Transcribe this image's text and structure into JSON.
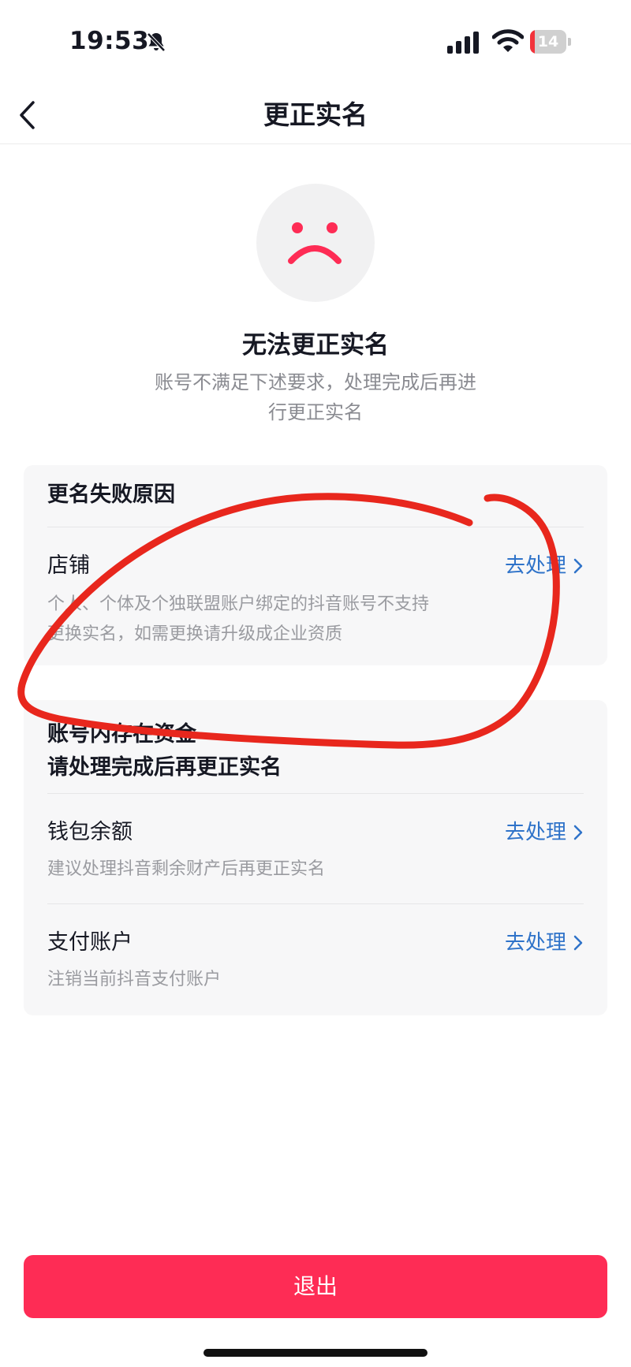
{
  "status_bar": {
    "time": "19:53",
    "battery_level": "14",
    "battery_fraction": 0.14
  },
  "nav": {
    "title": "更正实名"
  },
  "result": {
    "title": "无法更正实名",
    "desc_line1": "账号不满足下述要求，处理完成后再进",
    "desc_line2": "行更正实名"
  },
  "failure_card": {
    "header": "更名失败原因",
    "item": {
      "title": "店铺",
      "action": "去处理",
      "desc_line1": "个人、个体及个独联盟账户绑定的抖音账号不支持",
      "desc_line2": "更换实名，如需更换请升级成企业资质"
    }
  },
  "funds_card": {
    "header_line1": "账号内存在资金",
    "header_line2": "请处理完成后再更正实名",
    "items": [
      {
        "title": "钱包余额",
        "action": "去处理",
        "desc": "建议处理抖音剩余财产后再更正实名"
      },
      {
        "title": "支付账户",
        "action": "去处理",
        "desc": "注销当前抖音支付账户"
      }
    ]
  },
  "footer": {
    "exit_label": "退出"
  },
  "colors": {
    "accent_red": "#fe2c55",
    "link_blue": "#2f73c9",
    "annotation_red": "#e8271d"
  }
}
